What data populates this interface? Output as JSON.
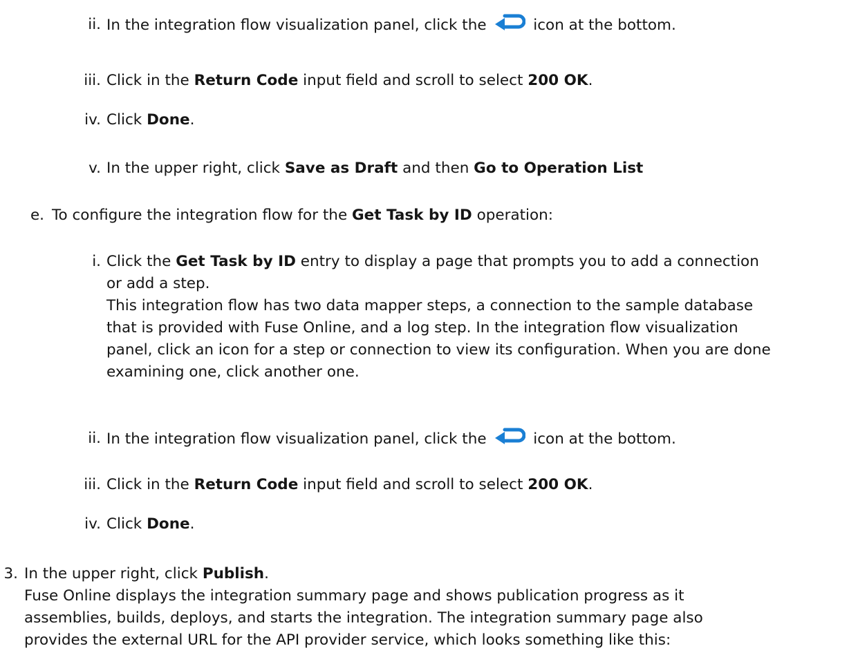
{
  "steps_part1": {
    "ii": {
      "marker": "ii.",
      "text_before": "In the integration flow visualization panel, click the",
      "icon": "return-arrow-icon",
      "text_after": "icon at the bottom."
    },
    "iii": {
      "marker": "iii.",
      "text_before": "Click in the",
      "bold1": "Return Code",
      "text_mid": "input field and scroll to select",
      "bold2": "200 OK",
      "text_after": "."
    },
    "iv": {
      "marker": "iv.",
      "text_before": "Click",
      "bold": "Done",
      "text_after": "."
    },
    "v": {
      "marker": "v.",
      "text_before": "In the upper right, click",
      "bold1": "Save as Draft",
      "text_mid": "and then",
      "bold2": "Go to Operation List"
    }
  },
  "step_e": {
    "marker": "e.",
    "text_before": "To configure the integration flow for the",
    "bold": "Get Task by ID",
    "text_after": "operation:"
  },
  "steps_part2": {
    "i": {
      "marker": "i.",
      "text_before": "Click the",
      "bold": "Get Task by ID",
      "text_after": "entry to display a page that prompts you to add a connection",
      "line2": "or add a step.",
      "para_line1": "This integration flow has two data mapper steps, a connection to the sample database",
      "para_line2": "that is provided with Fuse Online, and a log step. In the integration flow visualization",
      "para_line3": "panel, click an icon for a step or connection to view its configuration. When you are done",
      "para_line4": "examining one, click another one."
    },
    "ii": {
      "marker": "ii.",
      "text_before": "In the integration flow visualization panel, click the",
      "icon": "return-arrow-icon",
      "text_after": "icon at the bottom."
    },
    "iii": {
      "marker": "iii.",
      "text_before": "Click in the",
      "bold1": "Return Code",
      "text_mid": "input field and scroll to select",
      "bold2": "200 OK",
      "text_after": "."
    },
    "iv": {
      "marker": "iv.",
      "text_before": "Click",
      "bold": "Done",
      "text_after": "."
    }
  },
  "step_3": {
    "marker": "3.",
    "text_before": "In the upper right, click",
    "bold": "Publish",
    "text_after": ".",
    "para_line1": "Fuse Online displays the integration summary page and shows publication progress as it",
    "para_line2": "assemblies, builds, deploys, and starts the integration. The integration summary page also",
    "para_line3": "provides the external URL for the API provider service, which looks something like this:"
  },
  "colors": {
    "text": "#151515",
    "icon_blue": "#1a7fd4"
  }
}
